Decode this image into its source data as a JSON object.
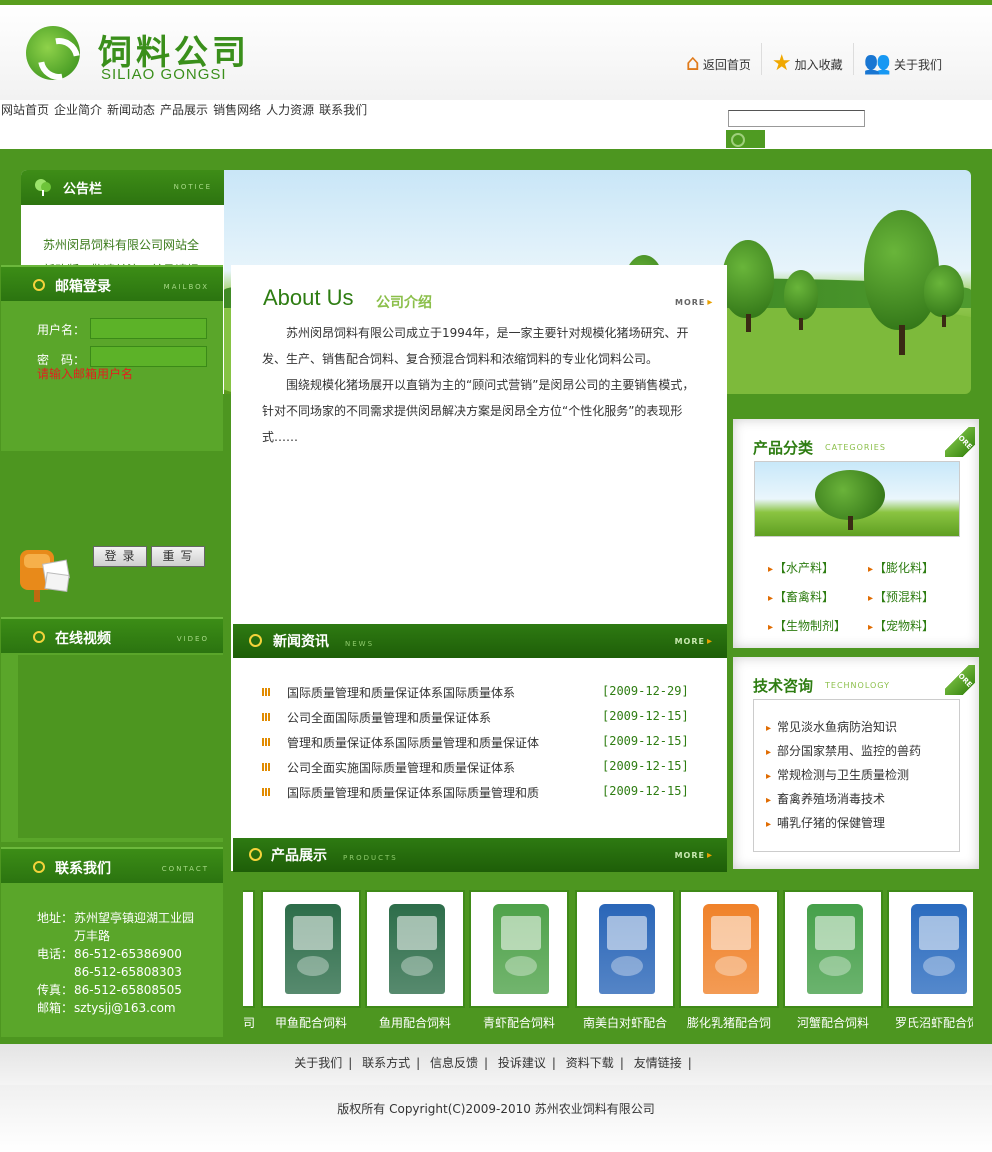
{
  "header": {
    "logo_cn": "饲料公司",
    "logo_en": "SILIAO GONGSI",
    "links": [
      {
        "label": "返回首页",
        "icon": "home-icon"
      },
      {
        "label": "加入收藏",
        "icon": "star-icon"
      },
      {
        "label": "关于我们",
        "icon": "user-icon"
      }
    ]
  },
  "nav": [
    "网站首页",
    "企业简介",
    "新闻动态",
    "产品展示",
    "销售网络",
    "人力资源",
    "联系我们"
  ],
  "search": {
    "value": "",
    "placeholder": ""
  },
  "notice": {
    "title": "公告栏",
    "en": "NOTICE",
    "text": "苏州闵昂饲料有限公司网站全新改版，敬请关注，并恳请提出宝贵意见和建议。"
  },
  "mail": {
    "title": "邮箱登录",
    "en": "MAILBOX",
    "user_label": "用户名：",
    "pass_label": "密　码：",
    "error": "请输入邮箱用户名",
    "login": "登录",
    "reset": "重写"
  },
  "video": {
    "title": "在线视频",
    "en": "VIDEO"
  },
  "contact": {
    "title": "联系我们",
    "en": "CONTACT",
    "address_label": "地址：",
    "address_1": "苏州望亭镇迎湖工业园",
    "address_2": "万丰路",
    "phone_label": "电话：",
    "phone_1": "86-512-65386900",
    "phone_2": "86-512-65808303",
    "fax_label": "传真：",
    "fax": "86-512-65808505",
    "email_label": "邮箱：",
    "email": "sztysjj@163.com"
  },
  "about": {
    "title": "About Us",
    "subtitle": "公司介绍",
    "more": "MORE",
    "p1": "苏州闵昂饲料有限公司成立于1994年，是一家主要针对规模化猪场研究、开发、生产、销售配合饲料、复合预混合饲料和浓缩饲料的专业化饲料公司。",
    "p2": "围绕规模化猪场展开以直销为主的“顾问式营销”是闵昂公司的主要销售模式，针对不同场家的不同需求提供闵昂解决方案是闵昂全方位“个性化服务”的表现形式……"
  },
  "news": {
    "title": "新闻资讯",
    "en": "NEWS",
    "more": "MORE",
    "items": [
      {
        "title": "国际质量管理和质量保证体系国际质量体系",
        "date": "[2009-12-29]"
      },
      {
        "title": "公司全面国际质量管理和质量保证体系",
        "date": "[2009-12-15]"
      },
      {
        "title": "管理和质量保证体系国际质量管理和质量保证体",
        "date": "[2009-12-15]"
      },
      {
        "title": "公司全面实施国际质量管理和质量保证体系",
        "date": "[2009-12-15]"
      },
      {
        "title": "国际质量管理和质量保证体系国际质量管理和质",
        "date": "[2009-12-15]"
      }
    ]
  },
  "products_bar": {
    "title": "产品展示",
    "en": "PRODUCTS",
    "more": "MORE"
  },
  "categories": {
    "title": "产品分类",
    "en": "CATEGORIES",
    "more": "MORE",
    "items": [
      "【水产料】",
      "【膨化料】",
      "【畜禽料】",
      "【预混料】",
      "【生物制剂】",
      "【宠物料】"
    ]
  },
  "tech": {
    "title": "技术咨询",
    "en": "TECHNOLOGY",
    "more": "MORE",
    "items": [
      "常见淡水鱼病防治知识",
      "部分国家禁用、监控的兽药",
      "常规检测与卫生质量检测",
      "畜禽养殖场消毒技术",
      "哺乳仔猪的保健管理"
    ]
  },
  "products": [
    {
      "name": "甲鱼配合饲料",
      "color": "#2d6d4a"
    },
    {
      "name": "鱼用配合饲料",
      "color": "#2d6d4a"
    },
    {
      "name": "青虾配合饲料",
      "color": "#4fa24a"
    },
    {
      "name": "南美白对虾配合",
      "color": "#2a66b8"
    },
    {
      "name": "膨化乳猪配合饲",
      "color": "#f0822a"
    },
    {
      "name": "河蟹配合饲料",
      "color": "#46a04a"
    },
    {
      "name": "罗氏沼虾配合饲",
      "color": "#2a6bbf"
    }
  ],
  "products_partial": "司",
  "footer": {
    "links": [
      "关于我们",
      "联系方式",
      "信息反馈",
      "投诉建议",
      "资料下载",
      "友情链接"
    ],
    "copyright": "版权所有 Copyright(C)2009-2010 苏州农业饲料有限公司"
  }
}
